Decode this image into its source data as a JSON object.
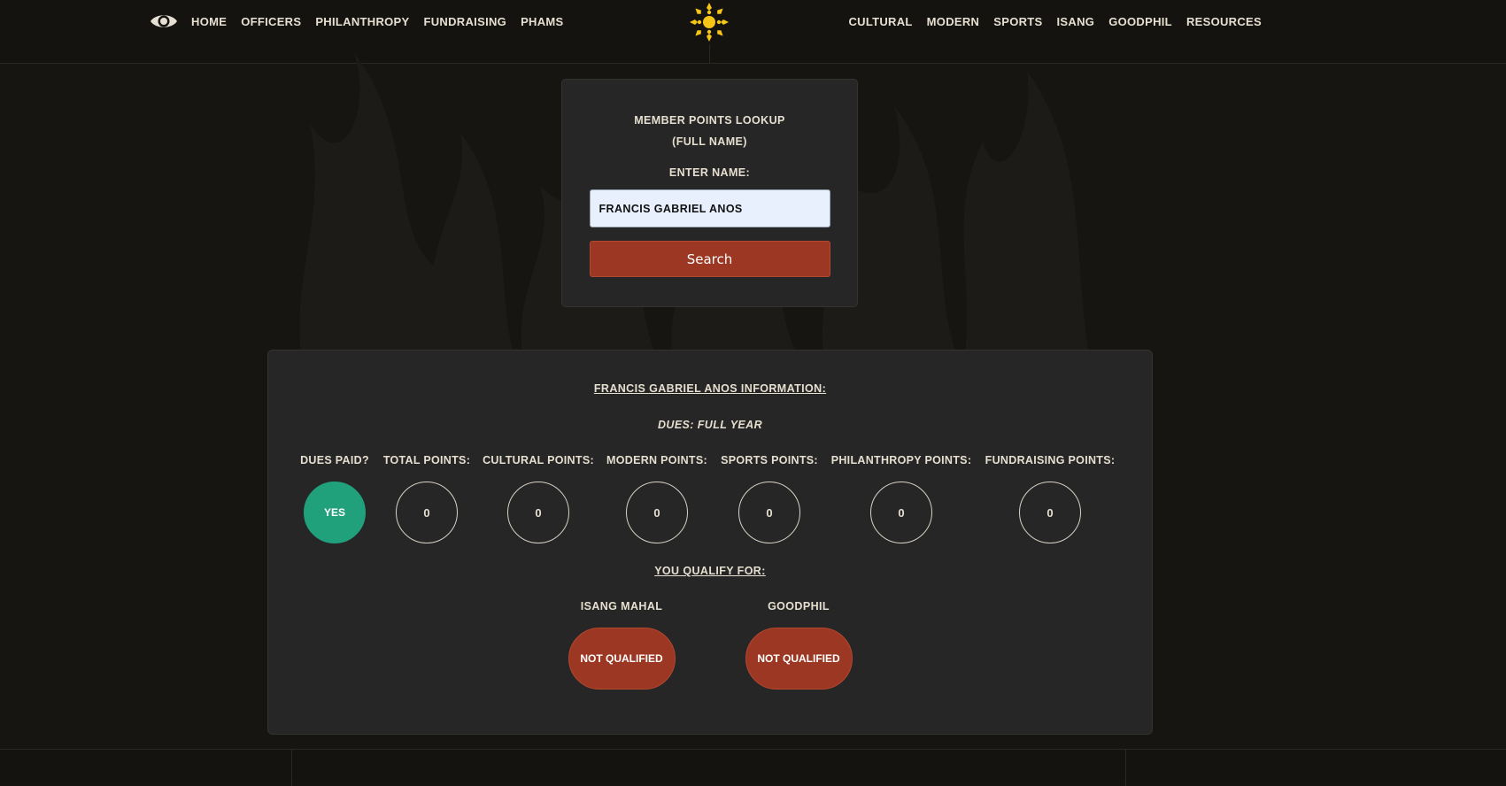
{
  "nav": {
    "left_items": [
      "HOME",
      "OFFICERS",
      "PHILANTHROPY",
      "FUNDRAISING",
      "PHAMS"
    ],
    "right_items": [
      "CULTURAL",
      "MODERN",
      "SPORTS",
      "ISANG",
      "GOODPHIL",
      "RESOURCES"
    ],
    "logo_icon": "sun-icon",
    "eye_icon": "eye-icon"
  },
  "lookup": {
    "title": "MEMBER POINTS LOOKUP\n(FULL NAME)",
    "enter_label": "ENTER NAME:",
    "input_value": "FRANCIS GABRIEL ANOS",
    "search_label": "Search"
  },
  "info": {
    "title": "FRANCIS GABRIEL ANOS INFORMATION:",
    "dues": "DUES: FULL YEAR",
    "stats": [
      {
        "label": "DUES PAID?",
        "value": "YES"
      },
      {
        "label": "TOTAL POINTS:",
        "value": "0"
      },
      {
        "label": "CULTURAL POINTS:",
        "value": "0"
      },
      {
        "label": "MODERN POINTS:",
        "value": "0"
      },
      {
        "label": "SPORTS POINTS:",
        "value": "0"
      },
      {
        "label": "PHILANTHROPY POINTS:",
        "value": "0"
      },
      {
        "label": "FUNDRAISING POINTS:",
        "value": "0"
      }
    ],
    "qualify_title": "YOU QUALIFY FOR:",
    "awards": [
      {
        "label": "ISANG MAHAL",
        "status": "NOT QUALIFIED"
      },
      {
        "label": "GOODPHIL",
        "status": "NOT QUALIFIED"
      }
    ]
  },
  "colors": {
    "background": "#161511",
    "card": "#262626",
    "accent_red": "#9b3722",
    "accent_green": "#21a07c",
    "logo_yellow": "#f5c518"
  }
}
